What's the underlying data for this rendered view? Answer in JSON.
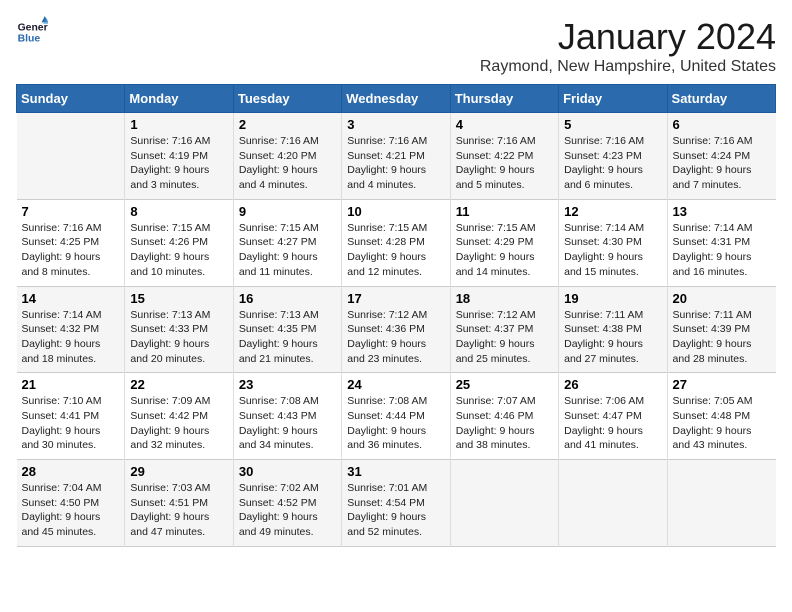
{
  "logo": {
    "line1": "General",
    "line2": "Blue"
  },
  "title": "January 2024",
  "subtitle": "Raymond, New Hampshire, United States",
  "headers": [
    "Sunday",
    "Monday",
    "Tuesday",
    "Wednesday",
    "Thursday",
    "Friday",
    "Saturday"
  ],
  "weeks": [
    [
      {
        "day": "",
        "info": ""
      },
      {
        "day": "1",
        "info": "Sunrise: 7:16 AM\nSunset: 4:19 PM\nDaylight: 9 hours\nand 3 minutes."
      },
      {
        "day": "2",
        "info": "Sunrise: 7:16 AM\nSunset: 4:20 PM\nDaylight: 9 hours\nand 4 minutes."
      },
      {
        "day": "3",
        "info": "Sunrise: 7:16 AM\nSunset: 4:21 PM\nDaylight: 9 hours\nand 4 minutes."
      },
      {
        "day": "4",
        "info": "Sunrise: 7:16 AM\nSunset: 4:22 PM\nDaylight: 9 hours\nand 5 minutes."
      },
      {
        "day": "5",
        "info": "Sunrise: 7:16 AM\nSunset: 4:23 PM\nDaylight: 9 hours\nand 6 minutes."
      },
      {
        "day": "6",
        "info": "Sunrise: 7:16 AM\nSunset: 4:24 PM\nDaylight: 9 hours\nand 7 minutes."
      }
    ],
    [
      {
        "day": "7",
        "info": "Sunrise: 7:16 AM\nSunset: 4:25 PM\nDaylight: 9 hours\nand 8 minutes."
      },
      {
        "day": "8",
        "info": "Sunrise: 7:15 AM\nSunset: 4:26 PM\nDaylight: 9 hours\nand 10 minutes."
      },
      {
        "day": "9",
        "info": "Sunrise: 7:15 AM\nSunset: 4:27 PM\nDaylight: 9 hours\nand 11 minutes."
      },
      {
        "day": "10",
        "info": "Sunrise: 7:15 AM\nSunset: 4:28 PM\nDaylight: 9 hours\nand 12 minutes."
      },
      {
        "day": "11",
        "info": "Sunrise: 7:15 AM\nSunset: 4:29 PM\nDaylight: 9 hours\nand 14 minutes."
      },
      {
        "day": "12",
        "info": "Sunrise: 7:14 AM\nSunset: 4:30 PM\nDaylight: 9 hours\nand 15 minutes."
      },
      {
        "day": "13",
        "info": "Sunrise: 7:14 AM\nSunset: 4:31 PM\nDaylight: 9 hours\nand 16 minutes."
      }
    ],
    [
      {
        "day": "14",
        "info": "Sunrise: 7:14 AM\nSunset: 4:32 PM\nDaylight: 9 hours\nand 18 minutes."
      },
      {
        "day": "15",
        "info": "Sunrise: 7:13 AM\nSunset: 4:33 PM\nDaylight: 9 hours\nand 20 minutes."
      },
      {
        "day": "16",
        "info": "Sunrise: 7:13 AM\nSunset: 4:35 PM\nDaylight: 9 hours\nand 21 minutes."
      },
      {
        "day": "17",
        "info": "Sunrise: 7:12 AM\nSunset: 4:36 PM\nDaylight: 9 hours\nand 23 minutes."
      },
      {
        "day": "18",
        "info": "Sunrise: 7:12 AM\nSunset: 4:37 PM\nDaylight: 9 hours\nand 25 minutes."
      },
      {
        "day": "19",
        "info": "Sunrise: 7:11 AM\nSunset: 4:38 PM\nDaylight: 9 hours\nand 27 minutes."
      },
      {
        "day": "20",
        "info": "Sunrise: 7:11 AM\nSunset: 4:39 PM\nDaylight: 9 hours\nand 28 minutes."
      }
    ],
    [
      {
        "day": "21",
        "info": "Sunrise: 7:10 AM\nSunset: 4:41 PM\nDaylight: 9 hours\nand 30 minutes."
      },
      {
        "day": "22",
        "info": "Sunrise: 7:09 AM\nSunset: 4:42 PM\nDaylight: 9 hours\nand 32 minutes."
      },
      {
        "day": "23",
        "info": "Sunrise: 7:08 AM\nSunset: 4:43 PM\nDaylight: 9 hours\nand 34 minutes."
      },
      {
        "day": "24",
        "info": "Sunrise: 7:08 AM\nSunset: 4:44 PM\nDaylight: 9 hours\nand 36 minutes."
      },
      {
        "day": "25",
        "info": "Sunrise: 7:07 AM\nSunset: 4:46 PM\nDaylight: 9 hours\nand 38 minutes."
      },
      {
        "day": "26",
        "info": "Sunrise: 7:06 AM\nSunset: 4:47 PM\nDaylight: 9 hours\nand 41 minutes."
      },
      {
        "day": "27",
        "info": "Sunrise: 7:05 AM\nSunset: 4:48 PM\nDaylight: 9 hours\nand 43 minutes."
      }
    ],
    [
      {
        "day": "28",
        "info": "Sunrise: 7:04 AM\nSunset: 4:50 PM\nDaylight: 9 hours\nand 45 minutes."
      },
      {
        "day": "29",
        "info": "Sunrise: 7:03 AM\nSunset: 4:51 PM\nDaylight: 9 hours\nand 47 minutes."
      },
      {
        "day": "30",
        "info": "Sunrise: 7:02 AM\nSunset: 4:52 PM\nDaylight: 9 hours\nand 49 minutes."
      },
      {
        "day": "31",
        "info": "Sunrise: 7:01 AM\nSunset: 4:54 PM\nDaylight: 9 hours\nand 52 minutes."
      },
      {
        "day": "",
        "info": ""
      },
      {
        "day": "",
        "info": ""
      },
      {
        "day": "",
        "info": ""
      }
    ]
  ]
}
